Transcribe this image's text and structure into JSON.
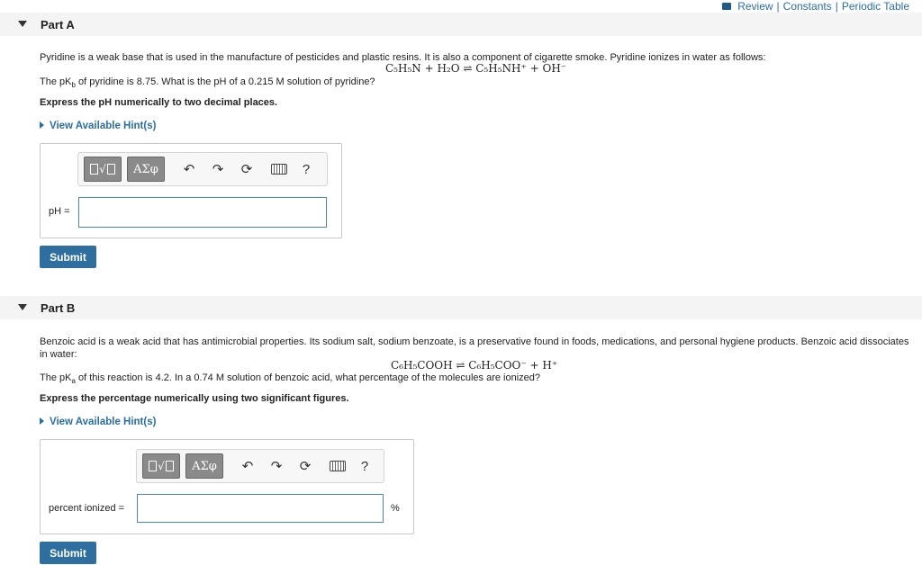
{
  "top_links": {
    "review": "Review",
    "sep1": "|",
    "constants": "Constants",
    "sep2": "|",
    "periodic": "Periodic Table"
  },
  "part_a": {
    "title": "Part A",
    "intro": "Pyridine is a weak base that is used in the manufacture of pesticides and plastic resins. It is also a component of cigarette smoke. Pyridine ionizes in water as follows:",
    "equation": "C₅H₅N + H₂O ⇌ C₅H₅NH⁺ + OH⁻",
    "question_pre": "The pK",
    "question_sub": "b",
    "question_post": " of pyridine is 8.75. What is the pH of a 0.215 M solution of pyridine?",
    "instruction": "Express the pH numerically to two decimal places.",
    "hint": "View Available Hint(s)",
    "input_label": "pH =",
    "submit": "Submit"
  },
  "part_b": {
    "title": "Part B",
    "intro": "Benzoic acid is a weak acid that has antimicrobial properties. Its sodium salt, sodium benzoate, is a preservative found in foods, medications, and personal hygiene products. Benzoic acid dissociates in water:",
    "equation": "C₆H₅COOH ⇌ C₆H₅COO⁻ + H⁺",
    "question_pre": "The pK",
    "question_sub": "a",
    "question_post": " of this reaction is 4.2. In a 0.74 M solution of benzoic acid, what percentage of the molecules are ionized?",
    "instruction": "Express the percentage numerically using two significant figures.",
    "hint": "View Available Hint(s)",
    "input_label": "percent ionized =",
    "unit": "%",
    "submit": "Submit"
  },
  "toolbar": {
    "greek": "ΑΣφ",
    "help": "?"
  }
}
